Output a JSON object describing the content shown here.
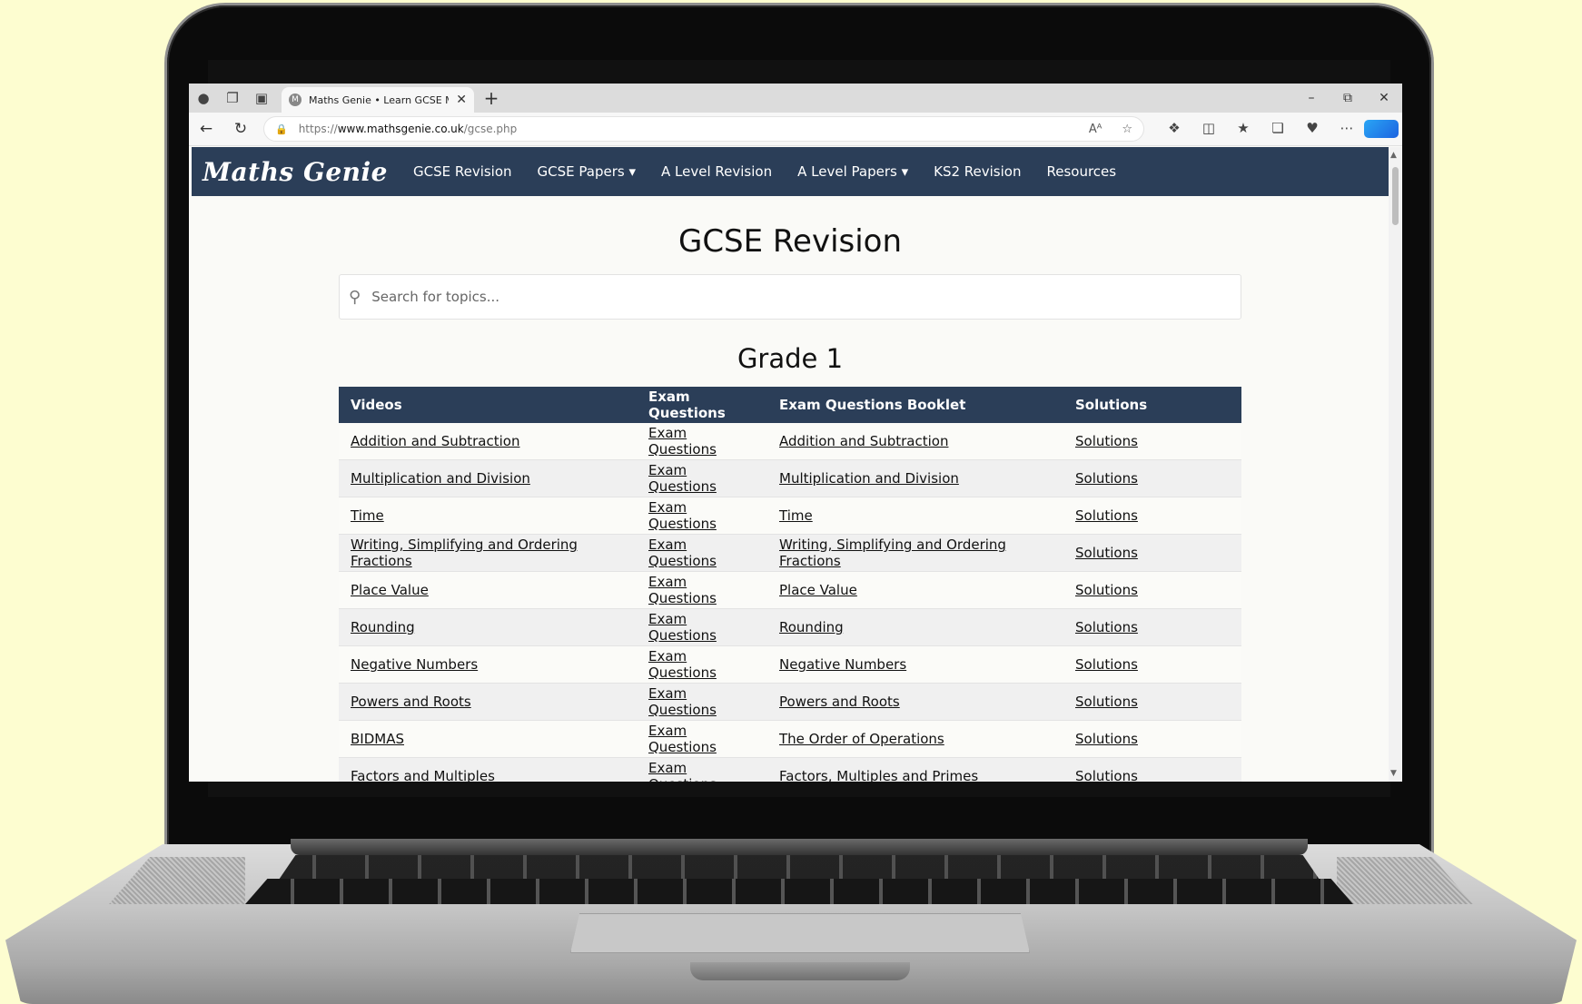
{
  "browser": {
    "tab_title": "Maths Genie • Learn GCSE Maths",
    "favicon_letter": "M",
    "url_prefix": "https://",
    "url_domain": "www.mathsgenie.co.uk",
    "url_path": "/gcse.php"
  },
  "site": {
    "logo": "Maths Genie",
    "nav": [
      "GCSE Revision",
      "GCSE Papers ▾",
      "A Level Revision",
      "A Level Papers ▾",
      "KS2 Revision",
      "Resources"
    ]
  },
  "page": {
    "title": "GCSE Revision",
    "search_placeholder": "Search for topics...",
    "grade_heading": "Grade 1"
  },
  "table": {
    "headers": [
      "Videos",
      "Exam Questions",
      "Exam Questions Booklet",
      "Solutions"
    ],
    "rows": [
      [
        "Addition and Subtraction",
        "Exam Questions",
        "Addition and Subtraction",
        "Solutions"
      ],
      [
        "Multiplication and Division",
        "Exam Questions",
        "Multiplication and Division",
        "Solutions"
      ],
      [
        "Time",
        "Exam Questions",
        "Time",
        "Solutions"
      ],
      [
        "Writing, Simplifying and Ordering Fractions",
        "Exam Questions",
        "Writing, Simplifying and Ordering Fractions",
        "Solutions"
      ],
      [
        "Place Value",
        "Exam Questions",
        "Place Value",
        "Solutions"
      ],
      [
        "Rounding",
        "Exam Questions",
        "Rounding",
        "Solutions"
      ],
      [
        "Negative Numbers",
        "Exam Questions",
        "Negative Numbers",
        "Solutions"
      ],
      [
        "Powers and Roots",
        "Exam Questions",
        "Powers and Roots",
        "Solutions"
      ],
      [
        "BIDMAS",
        "Exam Questions",
        "The Order of Operations",
        "Solutions"
      ],
      [
        "Factors and Multiples",
        "Exam Questions",
        "Factors, Multiples and Primes",
        "Solutions"
      ]
    ]
  },
  "colors": {
    "nav_bar": "#2b3e58",
    "background": "#fdfdd0"
  }
}
